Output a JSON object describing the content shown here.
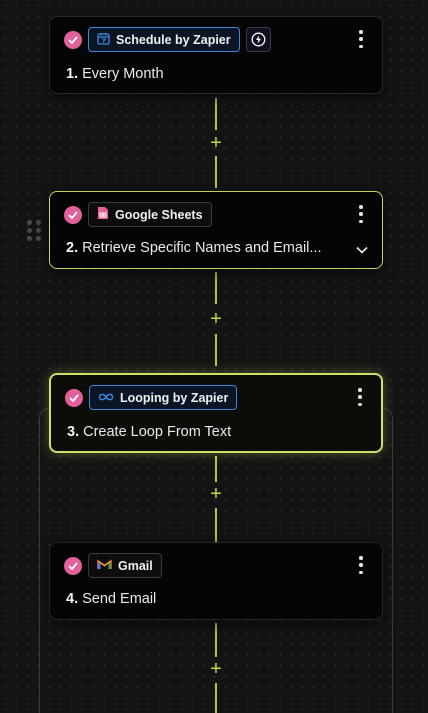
{
  "steps": [
    {
      "app": "Schedule by Zapier",
      "number": "1.",
      "title": "Every Month"
    },
    {
      "app": "Google Sheets",
      "number": "2.",
      "title": "Retrieve Specific Names and Email..."
    },
    {
      "app": "Looping by Zapier",
      "number": "3.",
      "title": "Create Loop From Text"
    },
    {
      "app": "Gmail",
      "number": "4.",
      "title": "Send Email"
    }
  ],
  "add_step_label": "+",
  "colors": {
    "connector": "#b9c33a",
    "check": "#e2609b",
    "active_border": "#d3dc6a",
    "zapier_blue": "#3f86df",
    "sheets_pink": "#e2609b"
  },
  "icons": {
    "step_status": "check-circle-icon",
    "schedule": "calendar-icon",
    "trigger": "lightning-bolt-icon",
    "sheets": "google-sheets-icon",
    "looping": "infinity-loop-icon",
    "gmail": "gmail-icon",
    "menu": "more-vertical-icon",
    "expand": "chevron-down-icon",
    "drag": "drag-handle-icon"
  }
}
